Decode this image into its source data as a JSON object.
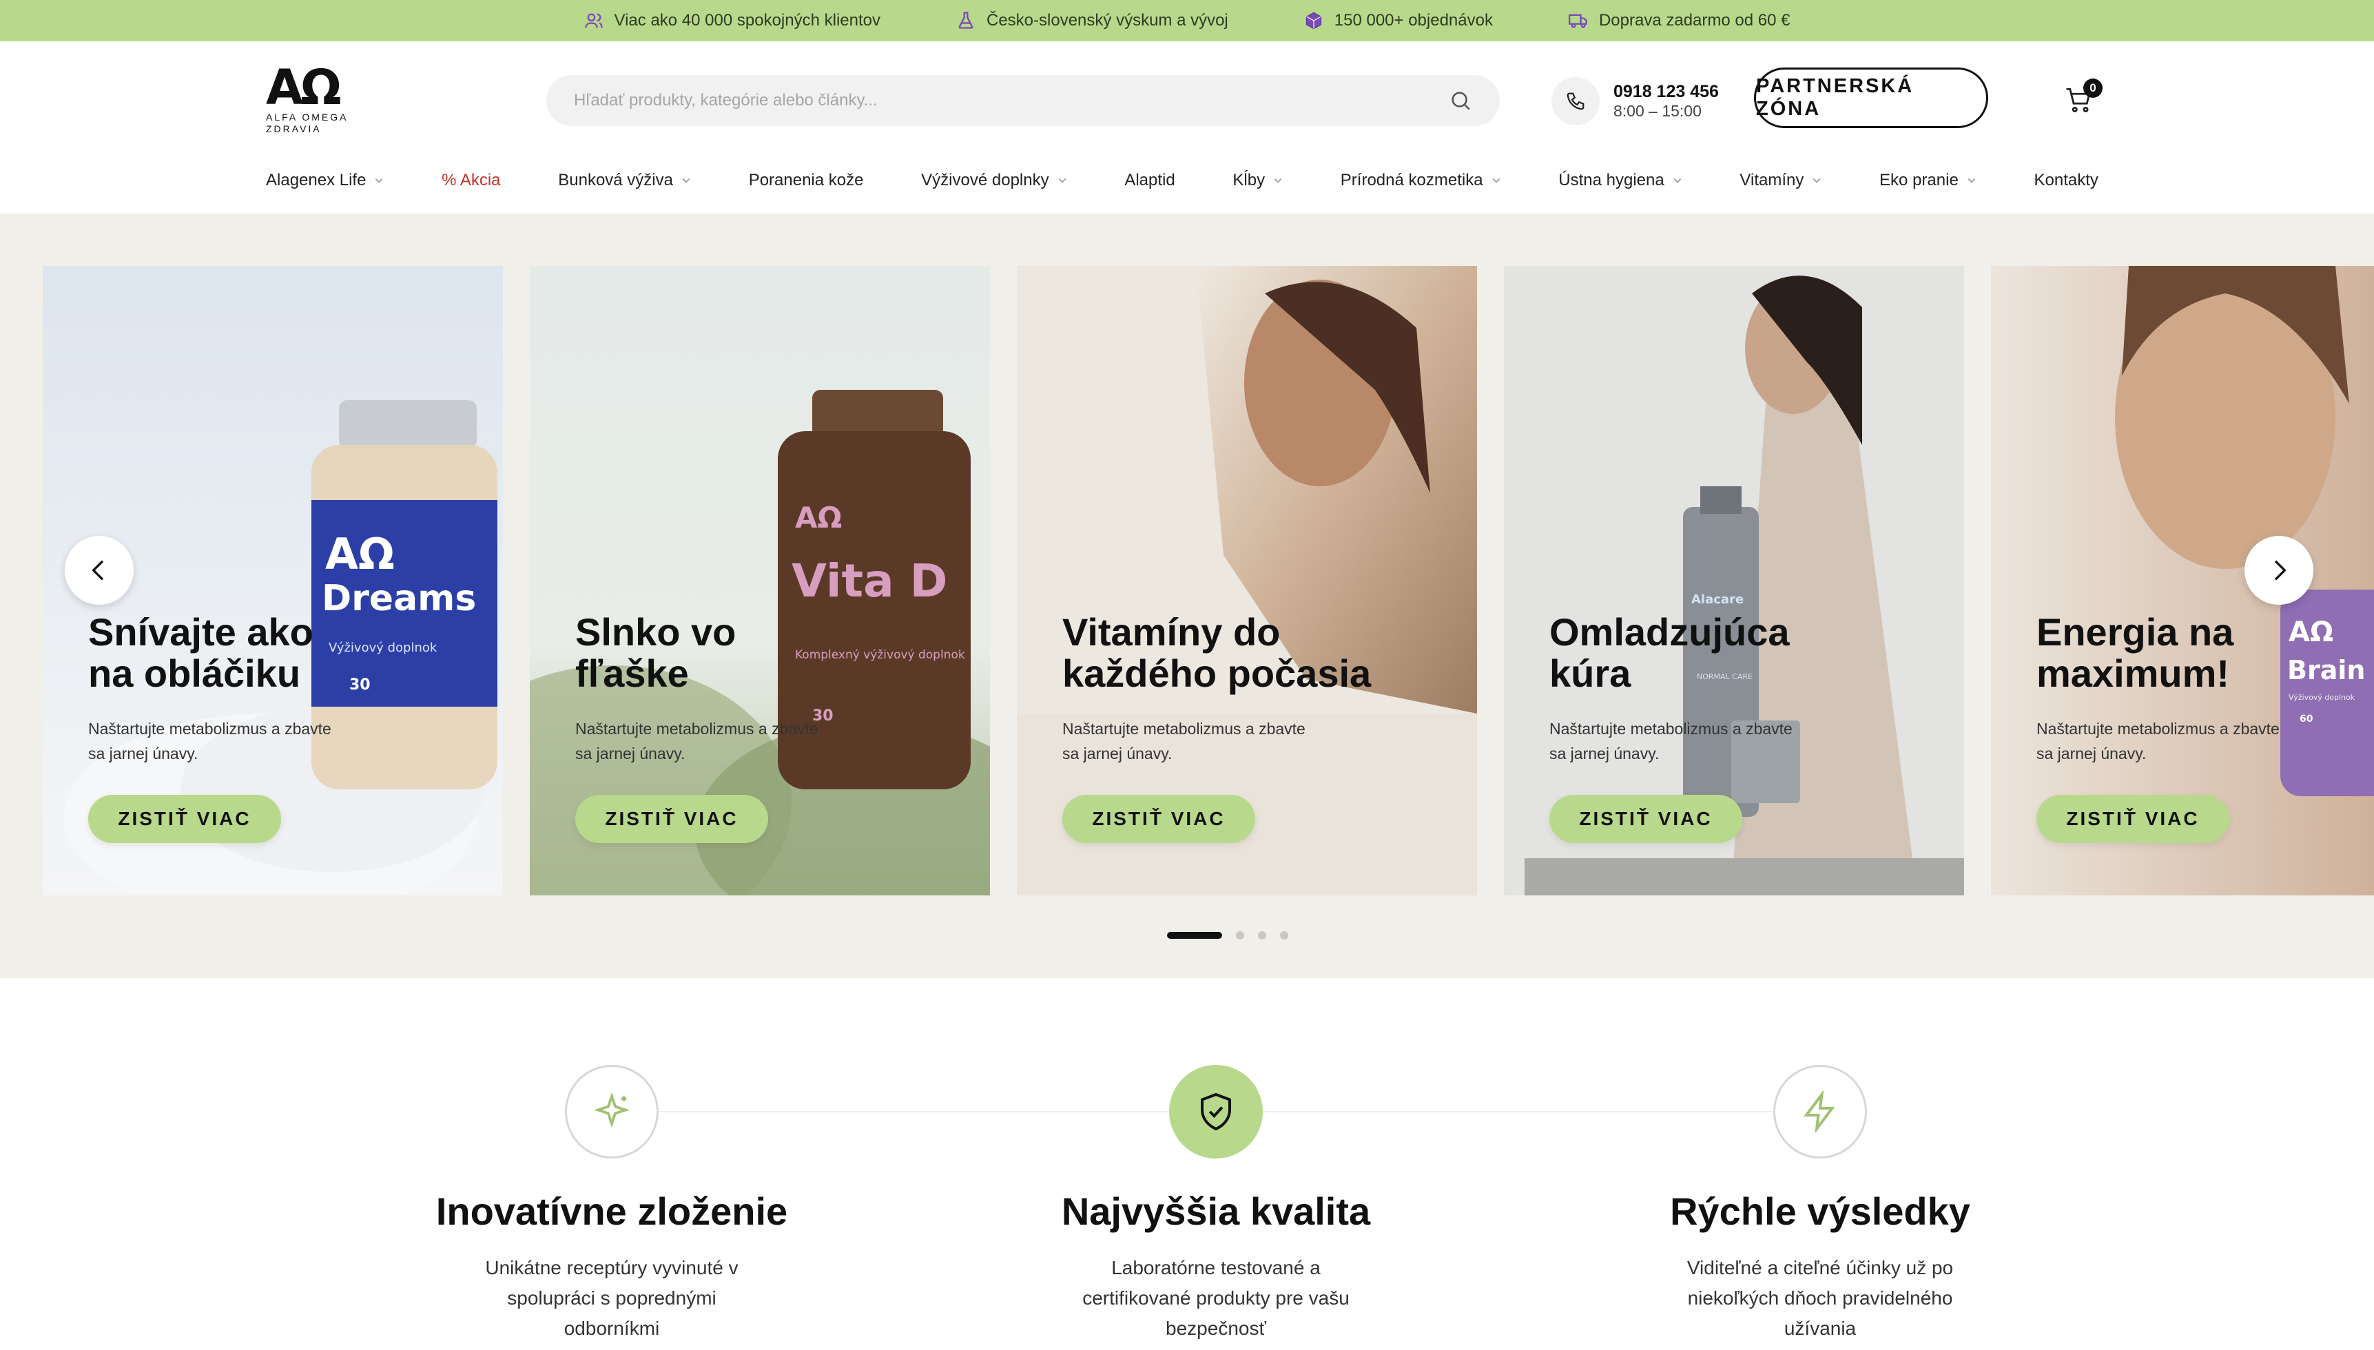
{
  "promo_bar": {
    "items": [
      {
        "icon": "users-icon",
        "text": "Viac ako 40 000 spokojných klientov"
      },
      {
        "icon": "flask-icon",
        "text": "Česko-slovenský výskum a vývoj"
      },
      {
        "icon": "box-icon",
        "text": "150 000+ objednávok"
      },
      {
        "icon": "truck-icon",
        "text": "Doprava zadarmo od 60 €"
      }
    ]
  },
  "header": {
    "logo_mark": "ΑΩ",
    "logo_text": "ALFA OMEGA ZDRAVIA",
    "search_placeholder": "Hľadať produkty, kategórie alebo články...",
    "phone_number": "0918 123 456",
    "phone_hours": "8:00 – 15:00",
    "partner_button": "PARTNERSKÁ ZÓNA",
    "cart_count": "0"
  },
  "nav": {
    "items": [
      {
        "label": "Alagenex Life",
        "dropdown": true
      },
      {
        "label": "% Akcia",
        "dropdown": false,
        "highlight": true
      },
      {
        "label": "Bunková výživa",
        "dropdown": true
      },
      {
        "label": "Poranenia kože",
        "dropdown": false
      },
      {
        "label": "Výživové doplnky",
        "dropdown": true
      },
      {
        "label": "Alaptid",
        "dropdown": false
      },
      {
        "label": "Kĺby",
        "dropdown": true
      },
      {
        "label": "Prírodná kozmetika",
        "dropdown": true
      },
      {
        "label": "Ústna hygiena",
        "dropdown": true
      },
      {
        "label": "Vitamíny",
        "dropdown": true
      },
      {
        "label": "Eko pranie",
        "dropdown": true
      },
      {
        "label": "Kontakty",
        "dropdown": false
      }
    ]
  },
  "hero": {
    "cards": [
      {
        "title": "Snívajte ako\nna obláčiku",
        "desc": "Naštartujte metabolizmus a zbavte sa jarnej únavy.",
        "button": "ZISTIŤ VIAC",
        "product_brand": "ΑΩ",
        "product_name": "Dreams",
        "product_sub": "Výživový doplnok",
        "product_count": "30"
      },
      {
        "title": "Slnko vo\nfľaške",
        "desc": "Naštartujte metabolizmus a zbavte sa jarnej únavy.",
        "button": "ZISTIŤ VIAC",
        "product_brand": "ΑΩ",
        "product_name": "Vita D",
        "product_sub": "Komplexný výživový doplnok",
        "product_count": "30"
      },
      {
        "title": "Vitamíny do\nkaždého počasia",
        "desc": "Naštartujte metabolizmus a zbavte sa jarnej únavy.",
        "button": "ZISTIŤ VIAC"
      },
      {
        "title": "Omladzujúca\nkúra",
        "desc": "Naštartujte metabolizmus a zbavte sa jarnej únavy.",
        "button": "ZISTIŤ VIAC",
        "product_name": "Alacare",
        "product_sub": "NORMAL CARE"
      },
      {
        "title": "Energia na\nmaximum!",
        "desc": "Naštartujte metabolizmus a zbavte sa jarnej únavy.",
        "button": "ZISTIŤ VIAC",
        "product_brand": "ΑΩ",
        "product_name": "Brain",
        "product_sub": "Výživový doplnok",
        "product_count": "60"
      }
    ],
    "slide_count": 4,
    "active_slide": 1
  },
  "features": [
    {
      "icon": "sparkle-icon",
      "title": "Inovatívne zloženie",
      "desc": "Unikátne receptúry vyvinuté v spolupráci s poprednými odborníkmi"
    },
    {
      "icon": "shield-check-icon",
      "title": "Najvyššia kvalita",
      "desc": "Laboratórne testované a certifikované produkty pre vašu bezpečnosť"
    },
    {
      "icon": "lightning-icon",
      "title": "Rýchle výsledky",
      "desc": "Viditeľné a citeľné účinky už po niekoľkých dňoch pravidelného užívania"
    }
  ],
  "colors": {
    "accent": "#b8d98c",
    "hero_bg": "#f1efe9",
    "sale": "#c5332a",
    "text": "#111111"
  }
}
